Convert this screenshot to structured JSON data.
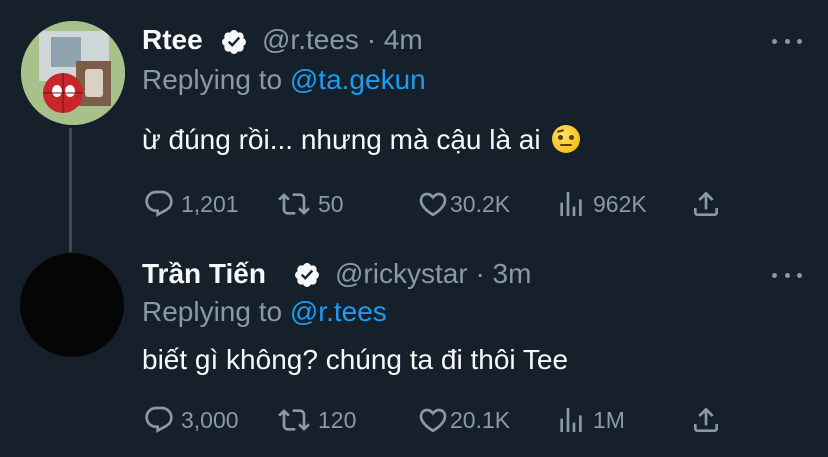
{
  "tweets": [
    {
      "name": "Rtee",
      "handle": "@r.tees",
      "time": "4m",
      "replying_prefix": "Replying to",
      "replying_to": "@ta.gekun",
      "text": "ừ đúng rồi... nhưng mà cậu là ai",
      "stats": {
        "replies": "1,201",
        "retweets": "50",
        "likes": "30.2K",
        "views": "962K"
      }
    },
    {
      "name": "Trần Tiến",
      "handle": "@rickystar",
      "time": "3m",
      "replying_prefix": "Replying to",
      "replying_to": "@r.tees",
      "text": "biết gì không? chúng ta đi thôi Tee",
      "stats": {
        "replies": "3,000",
        "retweets": "120",
        "likes": "20.1K",
        "views": "1M"
      }
    }
  ],
  "colors": {
    "background": "#15202b",
    "secondary_text": "#8b98a5",
    "mention": "#1d9bf0",
    "verified": "#f7f9f9"
  },
  "icons": [
    "verified-badge-icon",
    "more-icon",
    "reply-icon",
    "retweet-icon",
    "like-icon",
    "views-icon",
    "share-icon"
  ]
}
